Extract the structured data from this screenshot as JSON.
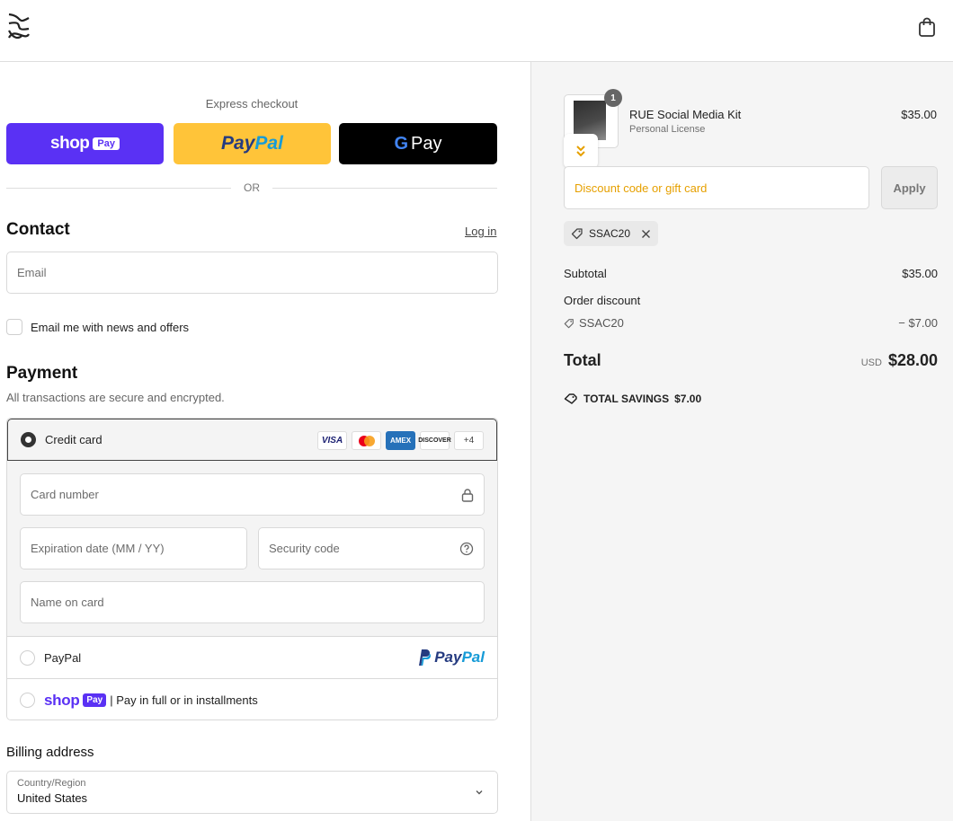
{
  "header": {
    "logo_icon": "store-logo-icon",
    "cart_icon": "shopping-bag-icon"
  },
  "express": {
    "title": "Express checkout",
    "shop_pay": {
      "word": "shop",
      "tag": "Pay",
      "color": "#5a31f4"
    },
    "paypal": {
      "pay": "Pay",
      "pal": "Pal",
      "color": "#ffc439"
    },
    "gpay": {
      "g": "G",
      "pay": "Pay",
      "color": "#000000"
    },
    "or_label": "OR"
  },
  "contact": {
    "title": "Contact",
    "login_link": "Log in",
    "email_placeholder": "Email",
    "newsletter_label": "Email me with news and offers"
  },
  "payment": {
    "title": "Payment",
    "subtitle": "All transactions are secure and encrypted.",
    "credit_card": {
      "label": "Credit card",
      "cards": [
        "VISA",
        "",
        "AMEX",
        "DISCOVER",
        "+4"
      ],
      "card_number_placeholder": "Card number",
      "expiration_placeholder": "Expiration date (MM / YY)",
      "security_placeholder": "Security code",
      "name_placeholder": "Name on card"
    },
    "paypal": {
      "label": "PayPal",
      "logo_pay": "Pay",
      "logo_pal": "Pal"
    },
    "shop_pay": {
      "word": "shop",
      "tag": "Pay",
      "label": "| Pay in full or in installments"
    }
  },
  "billing": {
    "title": "Billing address",
    "country_label": "Country/Region",
    "country_value": "United States"
  },
  "order": {
    "item": {
      "quantity": "1",
      "name": "RUE Social Media Kit",
      "variant": "Personal License",
      "price": "$35.00"
    },
    "discount_placeholder": "Discount code or gift card",
    "apply_label": "Apply",
    "applied_code": "SSAC20",
    "subtotal_label": "Subtotal",
    "subtotal_value": "$35.00",
    "order_discount_label": "Order discount",
    "discount_code": "SSAC20",
    "discount_value": "− $7.00",
    "total_label": "Total",
    "currency": "USD",
    "total_value": "$28.00",
    "savings_label": "TOTAL SAVINGS",
    "savings_value": "$7.00"
  }
}
